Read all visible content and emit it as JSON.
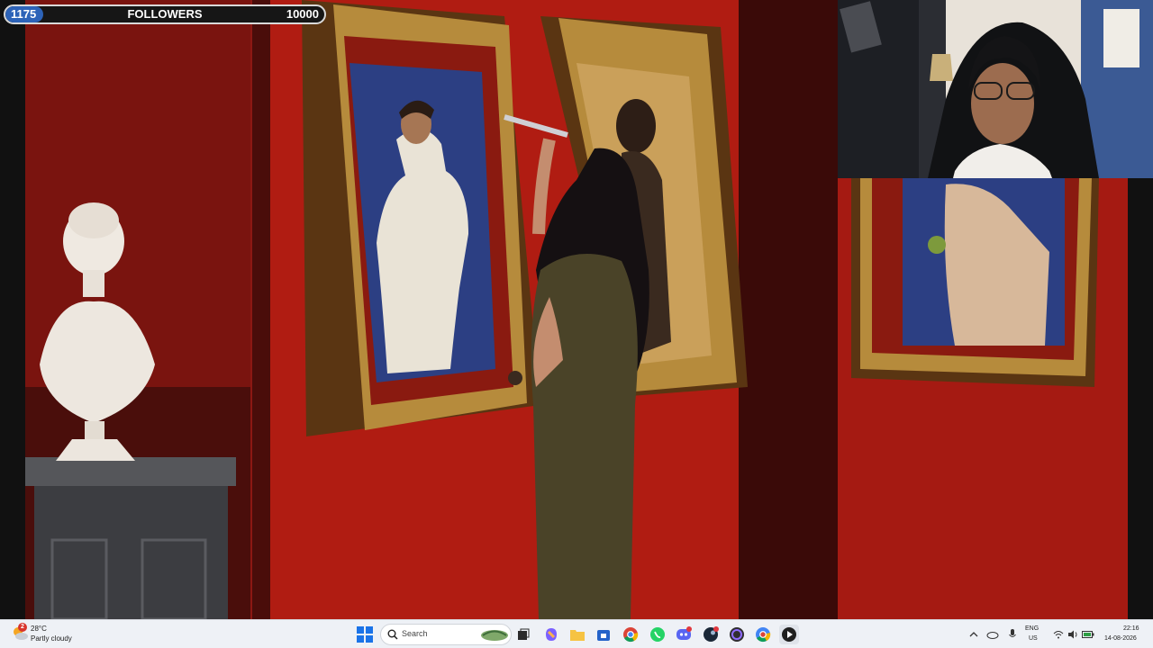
{
  "counter": {
    "current": "1175",
    "label": "FOLLOWERS",
    "target": "10000",
    "progress_fraction": 0.1175,
    "fill_color": "#2d63b8"
  },
  "video": {
    "background_color": "#8a1712",
    "webcam_present": true
  },
  "taskbar": {
    "weather": {
      "temperature": "28°C",
      "condition": "Partly cloudy",
      "notification_count": "2",
      "icon": "partly-cloudy-icon"
    },
    "search": {
      "placeholder": "Search",
      "icon": "search-icon"
    },
    "apps": [
      {
        "name": "landscape-widget-icon"
      },
      {
        "name": "task-view-icon"
      },
      {
        "name": "copilot-icon"
      },
      {
        "name": "file-explorer-icon"
      },
      {
        "name": "store-icon"
      },
      {
        "name": "chrome-icon"
      },
      {
        "name": "whatsapp-icon"
      },
      {
        "name": "discord-icon"
      },
      {
        "name": "steam-icon"
      },
      {
        "name": "obs-icon"
      },
      {
        "name": "chrome-beta-icon"
      },
      {
        "name": "media-player-icon"
      }
    ],
    "tray": {
      "language_top": "ENG",
      "language_bottom": "US",
      "time": "22:16",
      "date": "14-08-2026"
    }
  }
}
